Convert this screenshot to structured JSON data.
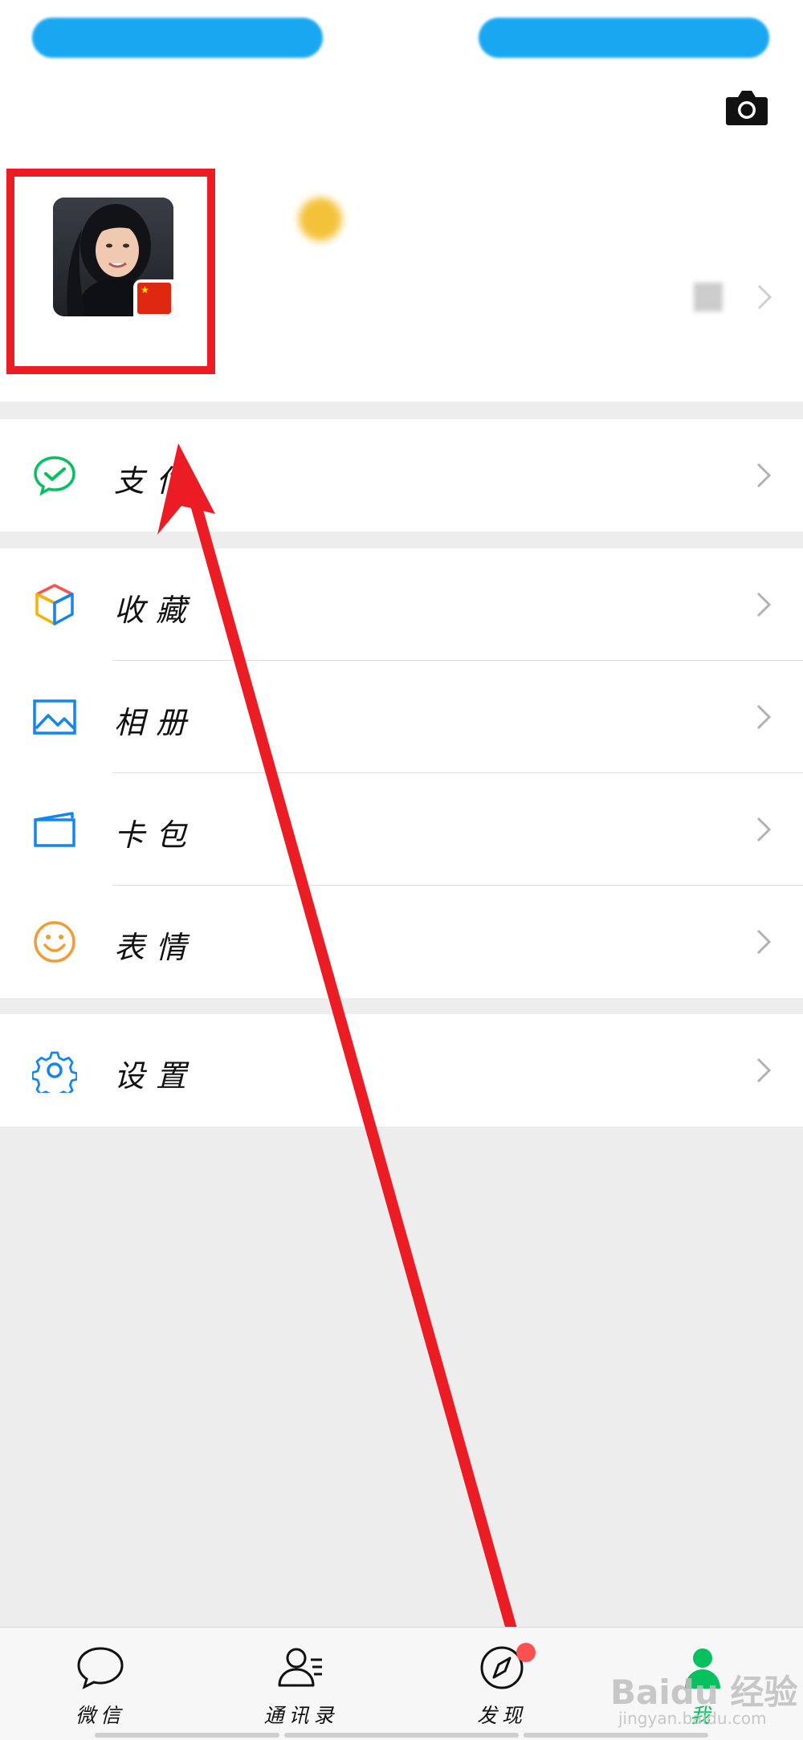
{
  "top_pills": {
    "left": "",
    "right": ""
  },
  "profile": {
    "nickname": "",
    "wechat_id": "",
    "flag_icon": "china-flag-icon"
  },
  "menu": {
    "pay": "支付",
    "favorites": "收藏",
    "album": "相册",
    "cards": "卡包",
    "stickers": "表情",
    "settings": "设置"
  },
  "tabs": [
    {
      "label": "微信",
      "icon": "chat-bubble-icon"
    },
    {
      "label": "通讯录",
      "icon": "contacts-icon"
    },
    {
      "label": "发现",
      "icon": "compass-icon"
    },
    {
      "label": "我",
      "icon": "me-icon",
      "active": true
    }
  ],
  "watermark": {
    "main": "Baidu 经验",
    "sub": "jingyan.baidu.com"
  },
  "colors": {
    "accent": "#07c160",
    "highlight": "#ec1c24",
    "pill": "#1aa7f2",
    "badge": "#fa5151"
  }
}
